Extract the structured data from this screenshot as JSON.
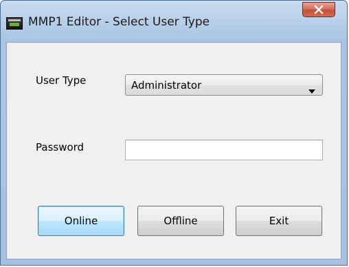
{
  "window": {
    "title": "MMP1 Editor - Select User Type",
    "close_icon": "close-icon"
  },
  "form": {
    "user_type_label": "User Type",
    "user_type_value": "Administrator",
    "password_label": "Password",
    "password_value": ""
  },
  "buttons": {
    "online": "Online",
    "offline": "Offline",
    "exit": "Exit"
  },
  "colors": {
    "titlebar": "#b7cfe8",
    "client": "#f0f0f0",
    "close_button": "#c24f38",
    "default_button_border": "#3c7fb1"
  }
}
